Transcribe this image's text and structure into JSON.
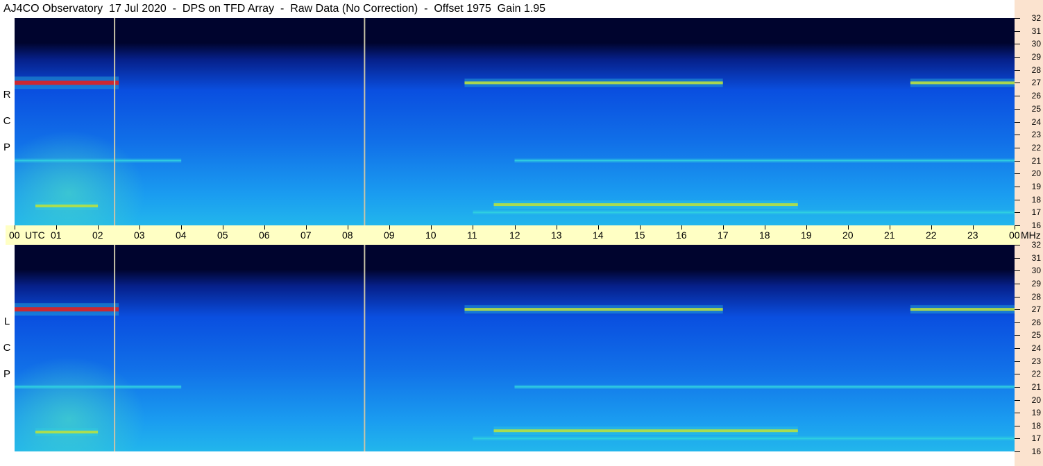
{
  "header": {
    "title": "AJ4CO Observatory  17 Jul 2020  -  DPS on TFD Array  -  Raw Data (No Correction)  -  Offset 1975  Gain 1.95"
  },
  "panels": [
    {
      "label": [
        "R",
        "C",
        "P"
      ]
    },
    {
      "label": [
        "L",
        "C",
        "P"
      ]
    }
  ],
  "freq_axis": {
    "unit": "MHz",
    "ticks": [
      "32",
      "31",
      "30",
      "29",
      "28",
      "27",
      "26",
      "25",
      "24",
      "23",
      "22",
      "21",
      "20",
      "19",
      "18",
      "17",
      "16"
    ]
  },
  "time_axis": {
    "labels": [
      "00",
      "01",
      "02",
      "03",
      "04",
      "05",
      "06",
      "07",
      "08",
      "09",
      "10",
      "11",
      "12",
      "13",
      "14",
      "15",
      "16",
      "17",
      "18",
      "19",
      "20",
      "21",
      "22",
      "23",
      "00"
    ],
    "utc_label": "UTC",
    "end_unit": "MHz"
  },
  "colors": {
    "background_dark": "#00042e",
    "mid_blue": "#0a4fe0",
    "light_blue": "#1a9cf0",
    "cyan": "#30d0e0",
    "green_yellow": "#b8e040",
    "red": "#e02020",
    "time_bar": "#ffffc4",
    "right_strip": "#fbe3cf"
  },
  "chart_data": {
    "type": "heatmap",
    "title": "AJ4CO Observatory  17 Jul 2020  -  DPS on TFD Array  -  Raw Data (No Correction)  -  Offset 1975  Gain 1.95",
    "xlabel": "UTC",
    "ylabel": "MHz",
    "x_range": [
      0,
      24
    ],
    "y_range": [
      16,
      32
    ],
    "panels": [
      "RCP",
      "LCP"
    ],
    "marker_lines_utc": [
      2.4,
      8.4
    ],
    "emission_bands_mhz": [
      {
        "freq": 27.0,
        "utc_from": 0.0,
        "utc_to": 2.5,
        "intensity": "high"
      },
      {
        "freq": 27.0,
        "utc_from": 10.8,
        "utc_to": 17.0,
        "intensity": "medium"
      },
      {
        "freq": 27.0,
        "utc_from": 21.5,
        "utc_to": 24.0,
        "intensity": "medium"
      },
      {
        "freq": 17.5,
        "utc_from": 0.5,
        "utc_to": 2.0,
        "intensity": "medium"
      },
      {
        "freq": 17.6,
        "utc_from": 11.5,
        "utc_to": 18.8,
        "intensity": "medium"
      },
      {
        "freq": 17.0,
        "utc_from": 11.0,
        "utc_to": 24.0,
        "intensity": "low"
      },
      {
        "freq": 21.0,
        "utc_from": 0.0,
        "utc_to": 4.0,
        "intensity": "low"
      },
      {
        "freq": 21.0,
        "utc_from": 12.0,
        "utc_to": 24.0,
        "intensity": "low"
      }
    ]
  }
}
